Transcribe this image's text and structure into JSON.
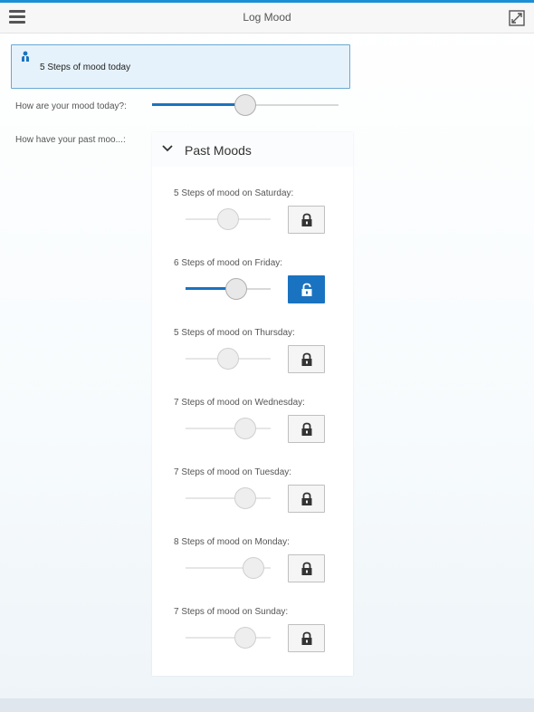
{
  "header": {
    "title": "Log Mood",
    "menu_icon": "hamburger-menu-icon",
    "expand_icon": "expand-icon"
  },
  "info_box": {
    "text": "5 Steps of mood today",
    "icon": "person-icon"
  },
  "today": {
    "label": "How are your mood today?:",
    "value": 5,
    "max": 10
  },
  "past": {
    "label": "How have your past moo...:",
    "panel_title": "Past Moods",
    "items": [
      {
        "label": "5 Steps of mood on Saturday:",
        "value": 5,
        "locked": true
      },
      {
        "label": "6 Steps of mood on Friday:",
        "value": 6,
        "locked": false
      },
      {
        "label": "5 Steps of mood on Thursday:",
        "value": 5,
        "locked": true
      },
      {
        "label": "7 Steps of mood on Wednesday:",
        "value": 7,
        "locked": true
      },
      {
        "label": "7 Steps of mood on Tuesday:",
        "value": 7,
        "locked": true
      },
      {
        "label": "8 Steps of mood on Monday:",
        "value": 8,
        "locked": true
      },
      {
        "label": "7 Steps of mood on Sunday:",
        "value": 7,
        "locked": true
      }
    ]
  },
  "colors": {
    "accent": "#1a73c0",
    "info_bg": "#e6f2fb",
    "info_border": "#6aa8d4"
  }
}
